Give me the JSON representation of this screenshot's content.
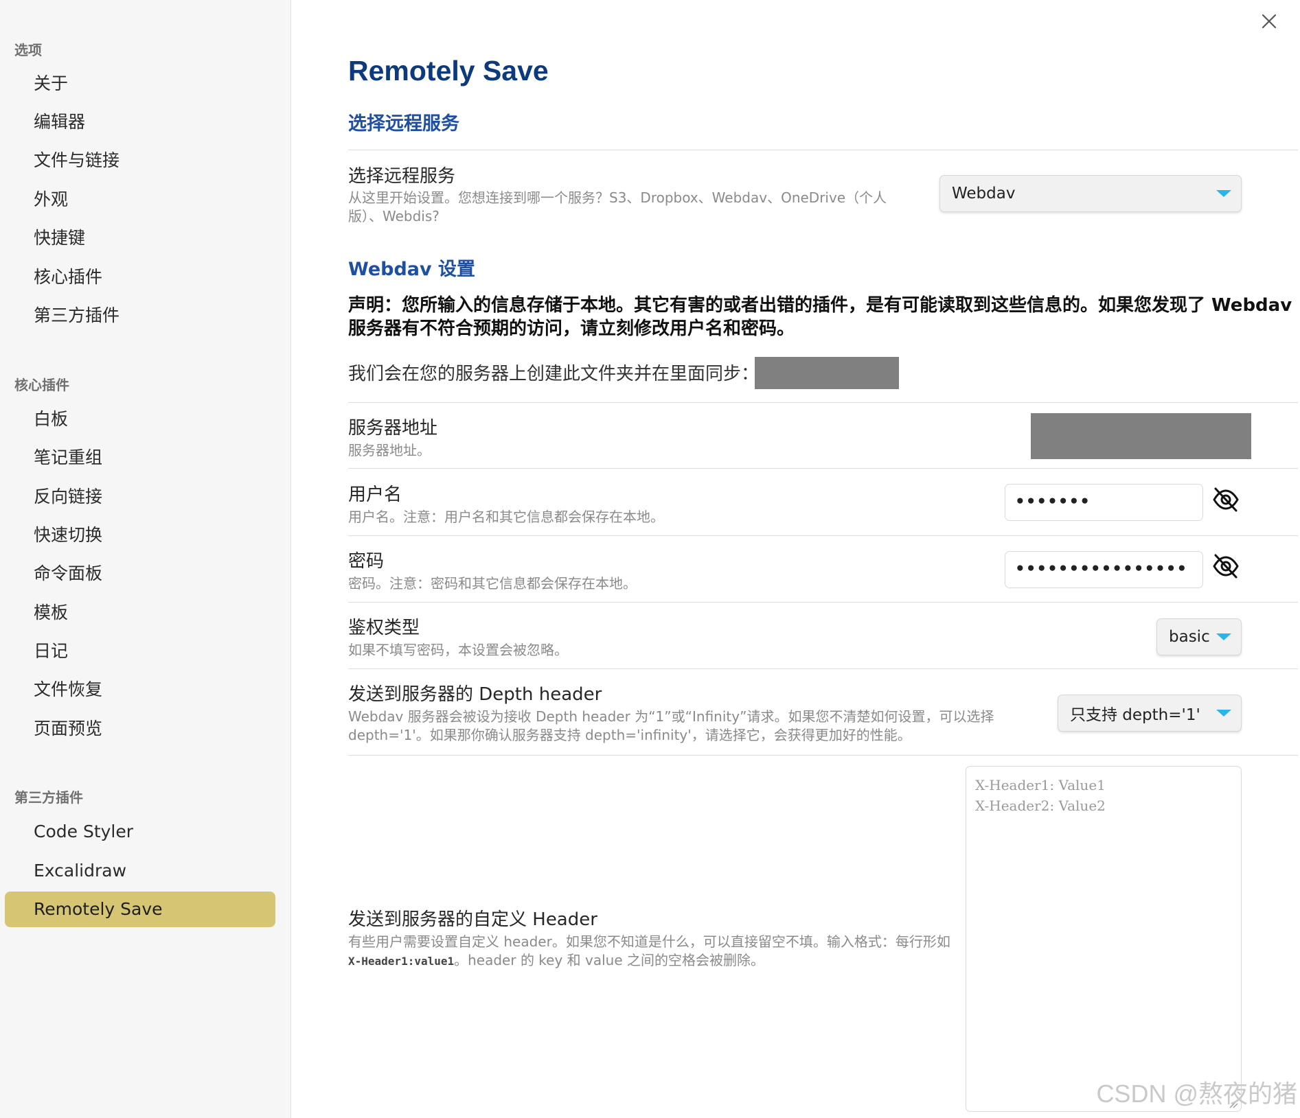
{
  "sidebar": {
    "groups": [
      {
        "title": "选项",
        "items": [
          "关于",
          "编辑器",
          "文件与链接",
          "外观",
          "快捷键",
          "核心插件",
          "第三方插件"
        ]
      },
      {
        "title": "核心插件",
        "items": [
          "白板",
          "笔记重组",
          "反向链接",
          "快速切换",
          "命令面板",
          "模板",
          "日记",
          "文件恢复",
          "页面预览"
        ]
      },
      {
        "title": "第三方插件",
        "items": [
          "Code Styler",
          "Excalidraw",
          "Remotely Save"
        ]
      }
    ],
    "active_item": "Remotely Save",
    "active_color": "#d6c572"
  },
  "close_icon": "close-icon",
  "main": {
    "title": "Remotely Save",
    "service_heading": "选择远程服务",
    "service": {
      "name": "选择远程服务",
      "desc": "从这里开始设置。您想连接到哪一个服务？S3、Dropbox、Webdav、OneDrive（个人版）、Webdis?",
      "value": "Webdav"
    },
    "webdav_heading": "Webdav 设置",
    "notice": "声明：您所输入的信息存储于本地。其它有害的或者出错的插件，是有可能读取到这些信息的。如果您发现了 Webdav 服务器有不符合预期的访问，请立刻修改用户名和密码。",
    "folder_text": "我们会在您的服务器上创建此文件夹并在里面同步：",
    "server": {
      "name": "服务器地址",
      "desc": "服务器地址。"
    },
    "username": {
      "name": "用户名",
      "desc": "用户名。注意：用户名和其它信息都会保存在本地。",
      "value": "•••••••",
      "toggle_icon": "eye-off-icon"
    },
    "password": {
      "name": "密码",
      "desc": "密码。注意：密码和其它信息都会保存在本地。",
      "value": "••••••••••••••••",
      "toggle_icon": "eye-off-icon"
    },
    "auth": {
      "name": "鉴权类型",
      "desc": "如果不填写密码，本设置会被忽略。",
      "value": "basic"
    },
    "depth": {
      "name": "发送到服务器的 Depth header",
      "desc": "Webdav 服务器会被设为接收 Depth header 为“1”或“Infinity”请求。如果您不清楚如何设置，可以选择 depth='1'。如果那你确认服务器支持 depth='infinity'，请选择它，会获得更加好的性能。",
      "value": "只支持 depth='1'"
    },
    "custom_header": {
      "name": "发送到服务器的自定义 Header",
      "desc_pre": "有些用户需要设置自定义 header。如果您不知道是什么，可以直接留空不填。输入格式：每行形如 ",
      "desc_code": "X-Header1:value1",
      "desc_post": "。header 的 key 和 value 之间的空格会被删除。",
      "placeholder_line1": "X-Header1: Value1",
      "placeholder_line2": "X-Header2: Value2"
    }
  },
  "watermark": "CSDN @熬夜的猪",
  "colors": {
    "title": "#0c3a7c",
    "heading": "#1f4fa0",
    "dropdown_arrow": "#2ab4e8",
    "redaction": "#808080"
  }
}
